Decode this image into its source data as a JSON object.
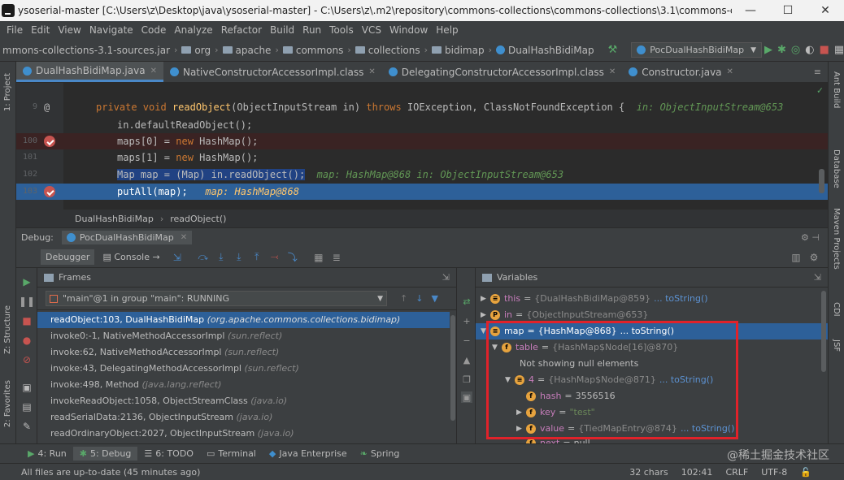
{
  "window": {
    "title": "ysoserial-master [C:\\Users\\z\\Desktop\\java\\ysoserial-master] - C:\\Users\\z\\.m2\\repository\\commons-collections\\commons-collections\\3.1\\commons-collections-",
    "minimize": "—",
    "maximize": "☐",
    "close": "✕"
  },
  "menu": [
    "File",
    "Edit",
    "View",
    "Navigate",
    "Code",
    "Analyze",
    "Refactor",
    "Build",
    "Run",
    "Tools",
    "VCS",
    "Window",
    "Help"
  ],
  "navbar": {
    "crumbs": [
      "mmons-collections-3.1-sources.jar",
      "org",
      "apache",
      "commons",
      "collections",
      "bidimap",
      "DualHashBidiMap"
    ],
    "run_config": "PocDualHashBidiMap"
  },
  "editor_tabs": [
    {
      "label": "DualHashBidiMap.java",
      "active": true
    },
    {
      "label": "NativeConstructorAccessorImpl.class",
      "active": false
    },
    {
      "label": "DelegatingConstructorAccessorImpl.class",
      "active": false
    },
    {
      "label": "Constructor.java",
      "active": false
    }
  ],
  "code": {
    "lines": [
      {
        "num": "9",
        "mark": "at"
      },
      {
        "num": "",
        "mark": ""
      },
      {
        "num": "100",
        "mark": "bp"
      },
      {
        "num": "101",
        "mark": ""
      },
      {
        "num": "102",
        "mark": ""
      },
      {
        "num": "103",
        "mark": "bp"
      }
    ],
    "l1_kw1": "private void ",
    "l1_fn": "readObject",
    "l1_args": "(ObjectInputStream in) ",
    "l1_kw2": "throws ",
    "l1_ex": "IOException, ClassNotFoundException {",
    "l1_hint": "in: ObjectInputStream@653",
    "l2": "in.defaultReadObject();",
    "l3_a": "maps[0] = ",
    "l3_kw": "new ",
    "l3_b": "HashMap();",
    "l4_a": "maps[1] = ",
    "l4_kw": "new ",
    "l4_b": "HashMap();",
    "l5_sel": "Map map = (Map) in.readObject();",
    "l5_hint": "map: HashMap@868   in: ObjectInputStream@653",
    "l6_code": "putAll(map);",
    "l6_hint": "map: HashMap@868"
  },
  "breadcrumb": [
    "DualHashBidiMap",
    "readObject()"
  ],
  "debug": {
    "label": "Debug:",
    "tab": "PocDualHashBidiMap",
    "subtabs": [
      "Debugger",
      "Console"
    ]
  },
  "frames": {
    "title": "Frames",
    "thread": "\"main\"@1 in group \"main\": RUNNING",
    "items": [
      {
        "method": "readObject:103, DualHashBidiMap",
        "pkg": "(org.apache.commons.collections.bidimap)",
        "selected": true
      },
      {
        "method": "invoke0:-1, NativeMethodAccessorImpl",
        "pkg": "(sun.reflect)",
        "selected": false
      },
      {
        "method": "invoke:62, NativeMethodAccessorImpl",
        "pkg": "(sun.reflect)",
        "selected": false
      },
      {
        "method": "invoke:43, DelegatingMethodAccessorImpl",
        "pkg": "(sun.reflect)",
        "selected": false
      },
      {
        "method": "invoke:498, Method",
        "pkg": "(java.lang.reflect)",
        "selected": false
      },
      {
        "method": "invokeReadObject:1058, ObjectStreamClass",
        "pkg": "(java.io)",
        "selected": false
      },
      {
        "method": "readSerialData:2136, ObjectInputStream",
        "pkg": "(java.io)",
        "selected": false
      },
      {
        "method": "readOrdinaryObject:2027, ObjectInputStream",
        "pkg": "(java.io)",
        "selected": false
      }
    ]
  },
  "variables": {
    "title": "Variables",
    "rows": [
      {
        "name": "this",
        "value": "{DualHashBidiMap@859}",
        "tostr": "... toString()"
      },
      {
        "name": "in",
        "value": "{ObjectInputStream@653}",
        "tostr": ""
      },
      {
        "name": "map",
        "value": "{HashMap@868}",
        "tostr": "... toString()"
      },
      {
        "name": "table",
        "value": "{HashMap$Node[16]@870}",
        "tostr": ""
      },
      {
        "text": "Not showing null elements"
      },
      {
        "name": "4",
        "value": "{HashMap$Node@871}",
        "tostr": "... toString()"
      },
      {
        "name": "hash",
        "value": "3556516",
        "tostr": ""
      },
      {
        "name": "key",
        "value": "\"test\"",
        "tostr": ""
      },
      {
        "name": "value",
        "value": "{TiedMapEntry@874}",
        "tostr": "... toString()"
      },
      {
        "name": "next",
        "value": "null",
        "tostr": ""
      }
    ],
    "highlight_color": "#e0222a"
  },
  "bottom_tabs": [
    {
      "icon": "▶",
      "label": "4: Run"
    },
    {
      "icon": "✱",
      "label": "5: Debug"
    },
    {
      "icon": "☰",
      "label": "6: TODO"
    },
    {
      "icon": "▭",
      "label": "Terminal"
    },
    {
      "icon": "◆",
      "label": "Java Enterprise"
    },
    {
      "icon": "❧",
      "label": "Spring"
    }
  ],
  "watermark": "@稀土掘金技术社区",
  "status": {
    "message": "All files are up-to-date (45 minutes ago)",
    "chars": "32 chars",
    "position": "102:41",
    "line_sep": "CRLF",
    "encoding": "UTF-8"
  },
  "side_labels": {
    "left": [
      "1: Project",
      "Z: Structure",
      "2: Favorites"
    ],
    "right": [
      "Ant Build",
      "Database",
      "Maven Projects",
      "CDI",
      "JSF"
    ]
  }
}
